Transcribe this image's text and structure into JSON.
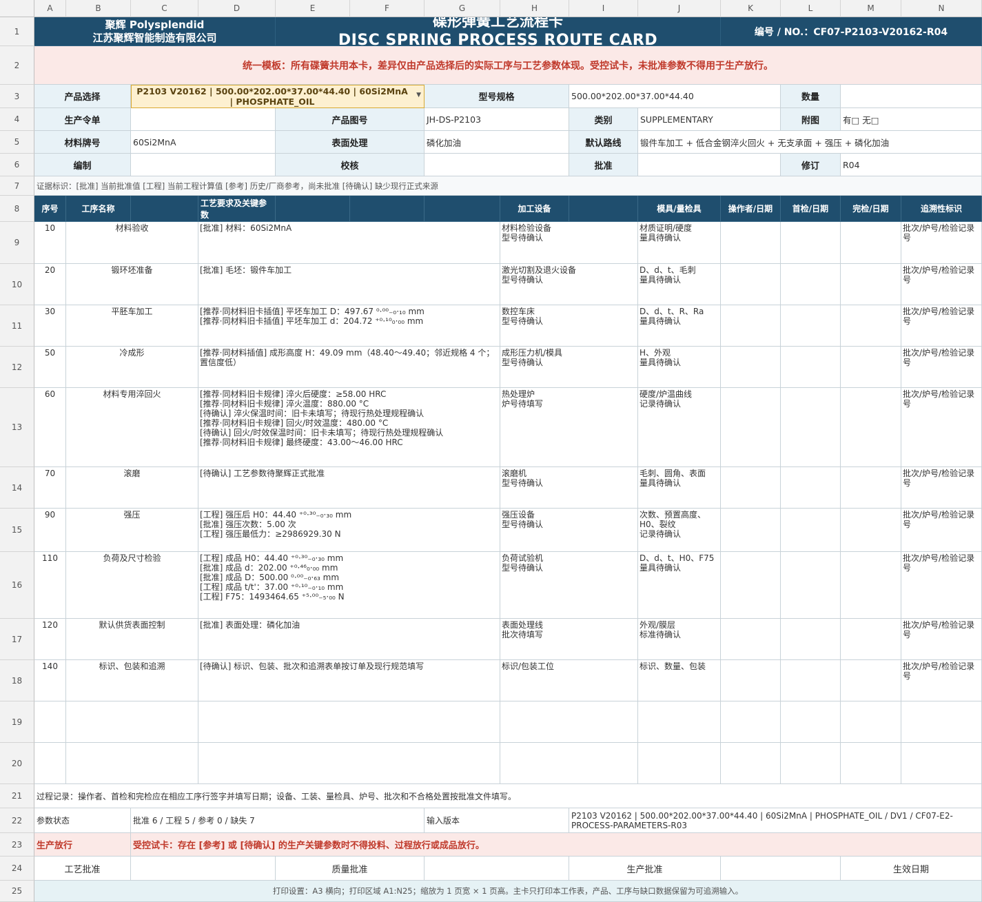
{
  "colors": {
    "title_bg": "#1f4e6e",
    "label_bg": "#e8f2f7",
    "warn_bg": "#fbe9e7",
    "warn_text": "#c0392b",
    "dropdown_bg": "#fdf0d0",
    "footer_bg": "#e6f2f5"
  },
  "columns": [
    "A",
    "B",
    "C",
    "D",
    "E",
    "F",
    "G",
    "H",
    "I",
    "J",
    "K",
    "L",
    "M",
    "N"
  ],
  "rows": [
    "1",
    "2",
    "3",
    "4",
    "5",
    "6",
    "7",
    "8",
    "9",
    "10",
    "11",
    "12",
    "13",
    "14",
    "15",
    "16",
    "17",
    "18",
    "19",
    "20",
    "21",
    "22",
    "23",
    "24",
    "25"
  ],
  "header": {
    "company_line1": "聚辉 Polysplendid",
    "company_line2": "江苏聚辉智能制造有限公司",
    "title_cn": "碟形弹簧工艺流程卡",
    "title_en": "DISC SPRING PROCESS ROUTE CARD",
    "number": "编号 / NO.：CF07-P2103-V20162-R04"
  },
  "notice": "统一模板：所有碟簧共用本卡，差异仅由产品选择后的实际工序与工艺参数体现。受控试卡，未批准参数不得用于生产放行。",
  "info": {
    "product_select_label": "产品选择",
    "product_select_value": "P2103 V20162 | 500.00*202.00*37.00*44.40 | 60Si2MnA | PHOSPHATE_OIL",
    "model_label": "型号规格",
    "model_value": "500.00*202.00*37.00*44.40",
    "qty_label": "数量",
    "qty_value": "",
    "order_label": "生产令单",
    "order_value": "",
    "drawing_label": "产品图号",
    "drawing_value": "JH-DS-P2103",
    "category_label": "类别",
    "category_value": "SUPPLEMENTARY",
    "attach_label": "附图",
    "attach_value": "有□  无□",
    "material_label": "材料牌号",
    "material_value": "60Si2MnA",
    "surface_label": "表面处理",
    "surface_value": "磷化加油",
    "route_label": "默认路线",
    "route_value": "锻件车加工 + 低合金钢淬火回火 + 无支承面 + 强压 + 磷化加油",
    "compile_label": "编制",
    "check_label": "校核",
    "approve_label": "批准",
    "revision_label": "修订",
    "revision_value": "R04"
  },
  "evidence_note": "证据标识：[批准] 当前批准值   [工程] 当前工程计算值   [参考] 历史/厂商参考，尚未批准   [待确认] 缺少现行正式来源",
  "table_header": {
    "seq": "序号",
    "name": "工序名称",
    "req": "工艺要求及关键参数",
    "equip": "加工设备",
    "tool": "模具/量检具",
    "operator": "操作者/日期",
    "first": "首检/日期",
    "final": "完检/日期",
    "trace": "追溯性标识"
  },
  "steps": [
    {
      "seq": "10",
      "name": "材料验收",
      "req": "[批准] 材料：60Si2MnA",
      "equip": "材料检验设备\n型号待确认",
      "tool": "材质证明/硬度\n量具待确认",
      "trace": "批次/炉号/检验记录号"
    },
    {
      "seq": "20",
      "name": "锻环坯准备",
      "req": "[批准] 毛坯：锻件车加工",
      "equip": "激光切割及退火设备\n型号待确认",
      "tool": "D、d、t、毛刺\n量具待确认",
      "trace": "批次/炉号/检验记录号"
    },
    {
      "seq": "30",
      "name": "平胚车加工",
      "req": "[推荐·同材料旧卡插值] 平坯车加工 D：497.67 ⁰·⁰⁰₋₀·₁₀ mm\n[推荐·同材料旧卡插值] 平坯车加工 d：204.72 ⁺⁰·¹⁰₀·₀₀ mm",
      "equip": "数控车床\n型号待确认",
      "tool": "D、d、t、R、Ra\n量具待确认",
      "trace": "批次/炉号/检验记录号"
    },
    {
      "seq": "50",
      "name": "冷成形",
      "req": "[推荐·同材料插值] 成形高度 H：49.09 mm（48.40～49.40；邻近规格 4 个；置信度低）",
      "equip": "成形压力机/模具\n型号待确认",
      "tool": "H、外观\n量具待确认",
      "trace": "批次/炉号/检验记录号"
    },
    {
      "seq": "60",
      "name": "材料专用淬回火",
      "req": "[推荐·同材料旧卡规律] 淬火后硬度：≥58.00 HRC\n[推荐·同材料旧卡规律] 淬火温度：880.00 °C\n[待确认] 淬火保温时间：旧卡未填写；待现行热处理规程确认\n[推荐·同材料旧卡规律] 回火/时效温度：480.00 °C\n[待确认] 回火/时效保温时间：旧卡未填写；待现行热处理规程确认\n[推荐·同材料旧卡规律] 最终硬度：43.00～46.00 HRC",
      "equip": "热处理炉\n炉号待填写",
      "tool": "硬度/炉温曲线\n记录待确认",
      "trace": "批次/炉号/检验记录号"
    },
    {
      "seq": "70",
      "name": "滚磨",
      "req": "[待确认] 工艺参数待聚辉正式批准",
      "equip": "滚磨机\n型号待确认",
      "tool": "毛刺、圆角、表面\n量具待确认",
      "trace": "批次/炉号/检验记录号"
    },
    {
      "seq": "90",
      "name": "强压",
      "req": "[工程] 强压后 H0：44.40 ⁺⁰·³⁰₋₀·₃₀ mm\n[批准] 强压次数：5.00 次\n[工程] 强压最低力：≥2986929.30 N",
      "equip": "强压设备\n型号待确认",
      "tool": "次数、预置高度、H0、裂纹\n记录待确认",
      "trace": "批次/炉号/检验记录号"
    },
    {
      "seq": "110",
      "name": "负荷及尺寸检验",
      "req": "[工程] 成品 H0：44.40 ⁺⁰·³⁰₋₀·₃₀ mm\n[批准] 成品 d：202.00 ⁺⁰·⁴⁶₀·₀₀ mm\n[批准] 成品 D：500.00 ⁰·⁰⁰₋₀·₆₃ mm\n[工程] 成品 t/t'：37.00 ⁺⁰·¹⁰₋₀·₁₀ mm\n[工程] F75：1493464.65 ⁺⁵·⁰⁰₋₅·₀₀ N",
      "equip": "负荷试验机\n型号待确认",
      "tool": "D、d、t、H0、F75\n量具待确认",
      "trace": "批次/炉号/检验记录号"
    },
    {
      "seq": "120",
      "name": "默认供货表面控制",
      "req": "[批准] 表面处理：磷化加油",
      "equip": "表面处理线\n批次待填写",
      "tool": "外观/膜层\n标准待确认",
      "trace": "批次/炉号/检验记录号"
    },
    {
      "seq": "140",
      "name": "标识、包装和追溯",
      "req": "[待确认] 标识、包装、批次和追溯表单按订单及现行规范填写",
      "equip": "标识/包装工位",
      "tool": "标识、数量、包装",
      "trace": "批次/炉号/检验记录号"
    }
  ],
  "process_record": "过程记录：操作者、首检和完检应在相应工序行签字并填写日期；设备、工装、量检具、炉号、批次和不合格处置按批准文件填写。",
  "param_status_label": "参数状态",
  "param_status_value": "批准 6 / 工程 5 / 参考 0 / 缺失 7",
  "input_version_label": "输入版本",
  "input_version_value": "P2103 V20162 | 500.00*202.00*37.00*44.40 | 60Si2MnA | PHOSPHATE_OIL / DV1 / CF07-E2-PROCESS-PARAMETERS-R03",
  "release_label": "生产放行",
  "release_value": "受控试卡：存在 [参考] 或 [待确认] 的生产关键参数时不得投料、过程放行或成品放行。",
  "approvals": {
    "process": "工艺批准",
    "quality": "质量批准",
    "production": "生产批准",
    "effective": "生效日期"
  },
  "print_setting": "打印设置：A3 横向；打印区域 A1:N25；缩放为 1 页宽 × 1 页高。主卡只打印本工作表，产品、工序与缺口数据保留为可追溯输入。"
}
